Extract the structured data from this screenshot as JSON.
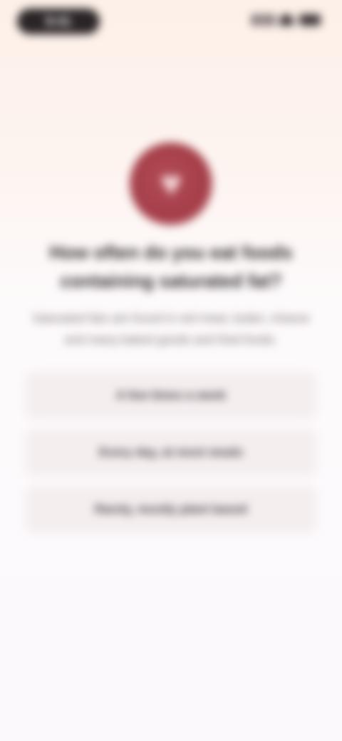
{
  "status_bar": {
    "time": "9:41"
  },
  "hero": {
    "icon": "heart-icon",
    "color": "#a83f49"
  },
  "prompt": {
    "title": "How often do you eat foods containing saturated fat?",
    "subtitle": "Saturated fats are found in red meat, butter, cheese and many baked goods and fried foods."
  },
  "options": [
    {
      "label": "A few times a week"
    },
    {
      "label": "Every day, at most meals"
    },
    {
      "label": "Rarely, mostly plant based"
    }
  ],
  "colors": {
    "background_top": "#fdf0e8",
    "background_bottom": "#fcf9fd",
    "option_bg": "#f5eeef",
    "accent": "#a83f49"
  }
}
